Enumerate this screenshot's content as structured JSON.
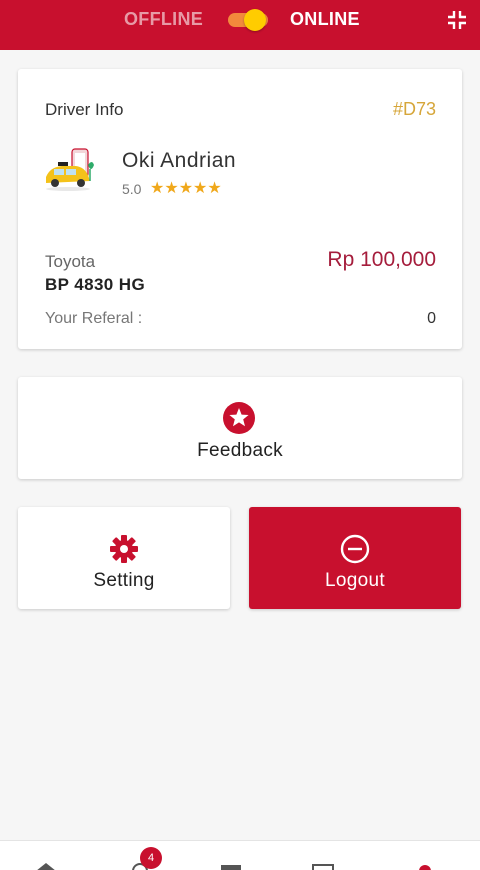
{
  "header": {
    "offline_label": "OFFLINE",
    "online_label": "ONLINE",
    "status_on": true,
    "icons": [
      "toggle-switch",
      "collapse-icon"
    ]
  },
  "driver": {
    "section_title": "Driver Info",
    "code": "#D73",
    "name": "Oki Andrian",
    "rating": "5.0",
    "stars": "★★★★★",
    "vehicle_brand": "Toyota",
    "plate": "BP 4830 HG",
    "balance": "Rp 100,000",
    "referral_label": "Your Referal :",
    "referral_value": "0"
  },
  "actions": {
    "feedback_label": "Feedback",
    "setting_label": "Setting",
    "logout_label": "Logout"
  },
  "bottom_nav": {
    "badge_count": "4",
    "items": [
      "home-icon",
      "bike-icon",
      "list-icon",
      "document-icon",
      "profile-icon"
    ]
  },
  "colors": {
    "primary": "#c8102e",
    "accent_gold": "#d6a63a",
    "star": "#f0a81b",
    "money": "#a51d3c"
  }
}
